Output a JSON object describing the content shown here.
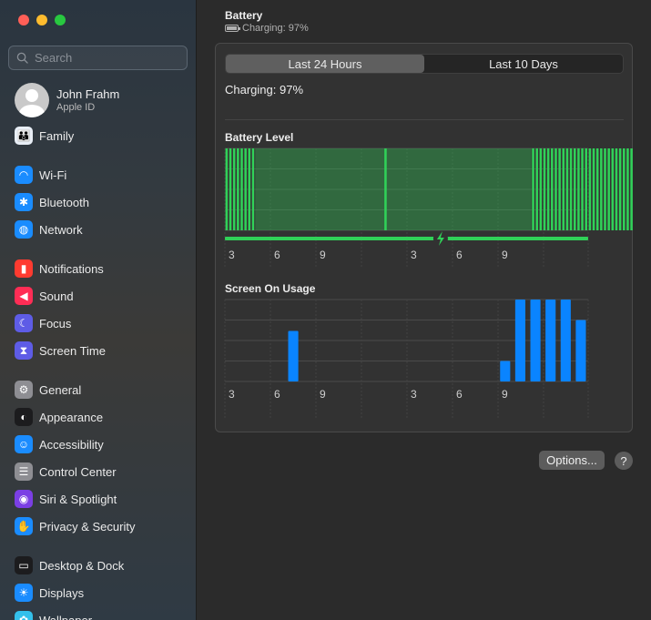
{
  "sidebar": {
    "search": {
      "placeholder": "Search"
    },
    "user": {
      "name": "John Frahm",
      "subtitle": "Apple ID"
    },
    "items": [
      {
        "label": "Family",
        "icon": "family-icon",
        "color": "#e8eef6",
        "glyph": "👪"
      },
      {
        "label": "Wi-Fi",
        "icon": "wifi-icon",
        "color": "#1a8cff",
        "glyph": "◠"
      },
      {
        "label": "Bluetooth",
        "icon": "bluetooth-icon",
        "color": "#1a8cff",
        "glyph": "✱"
      },
      {
        "label": "Network",
        "icon": "globe-icon",
        "color": "#1a8cff",
        "glyph": "◍"
      },
      {
        "label": "Notifications",
        "icon": "bell-icon",
        "color": "#ff3b30",
        "glyph": "▮"
      },
      {
        "label": "Sound",
        "icon": "speaker-icon",
        "color": "#ff2d55",
        "glyph": "◀"
      },
      {
        "label": "Focus",
        "icon": "moon-icon",
        "color": "#5e5ce6",
        "glyph": "☾"
      },
      {
        "label": "Screen Time",
        "icon": "hourglass-icon",
        "color": "#5e5ce6",
        "glyph": "⧗"
      },
      {
        "label": "General",
        "icon": "gear-icon",
        "color": "#8e8e93",
        "glyph": "⚙"
      },
      {
        "label": "Appearance",
        "icon": "appearance-icon",
        "color": "#1c1c1e",
        "glyph": "◐"
      },
      {
        "label": "Accessibility",
        "icon": "accessibility-icon",
        "color": "#1a8cff",
        "glyph": "☺"
      },
      {
        "label": "Control Center",
        "icon": "toggles-icon",
        "color": "#8e8e93",
        "glyph": "☰"
      },
      {
        "label": "Siri & Spotlight",
        "icon": "siri-icon",
        "color": "#7b3fe4",
        "glyph": "◉"
      },
      {
        "label": "Privacy & Security",
        "icon": "hand-icon",
        "color": "#1a8cff",
        "glyph": "✋"
      },
      {
        "label": "Desktop & Dock",
        "icon": "dock-icon",
        "color": "#1c1c1e",
        "glyph": "▭"
      },
      {
        "label": "Displays",
        "icon": "sun-icon",
        "color": "#1a8cff",
        "glyph": "☀"
      },
      {
        "label": "Wallpaper",
        "icon": "wallpaper-icon",
        "color": "#34c0eb",
        "glyph": "✿"
      }
    ]
  },
  "header": {
    "title": "Battery",
    "status": "Charging: 97%"
  },
  "tabs": [
    {
      "label": "Last 24 Hours",
      "active": true
    },
    {
      "label": "Last 10 Days",
      "active": false
    }
  ],
  "charging_text": "Charging: 97%",
  "options_label": "Options...",
  "help_label": "?",
  "colors": {
    "battery_green": "#30d158",
    "usage_blue": "#0a84ff"
  },
  "chart_data": [
    {
      "type": "bar",
      "title": "Battery Level",
      "x_tick_labels": [
        "3",
        "6",
        "9",
        "3",
        "6",
        "9"
      ],
      "ylim": [
        0,
        100
      ],
      "description_units": "percent, 15-minute intervals",
      "segments": [
        {
          "start_slot": 0,
          "end_slot": 8,
          "value": 100
        },
        {
          "start_slot": 42,
          "end_slot": 43,
          "value": 100
        },
        {
          "start_slot": 81,
          "end_slot": 113,
          "value": 100
        }
      ],
      "charging_icon_slot": 57
    },
    {
      "type": "bar",
      "title": "Screen On Usage",
      "x_tick_labels": [
        "3",
        "6",
        "9",
        "3",
        "6",
        "9"
      ],
      "ylim": [
        0,
        60
      ],
      "hours": [
        4,
        18,
        19,
        20,
        21,
        22,
        23
      ],
      "values": [
        37,
        15,
        60,
        60,
        60,
        60,
        45
      ]
    }
  ]
}
